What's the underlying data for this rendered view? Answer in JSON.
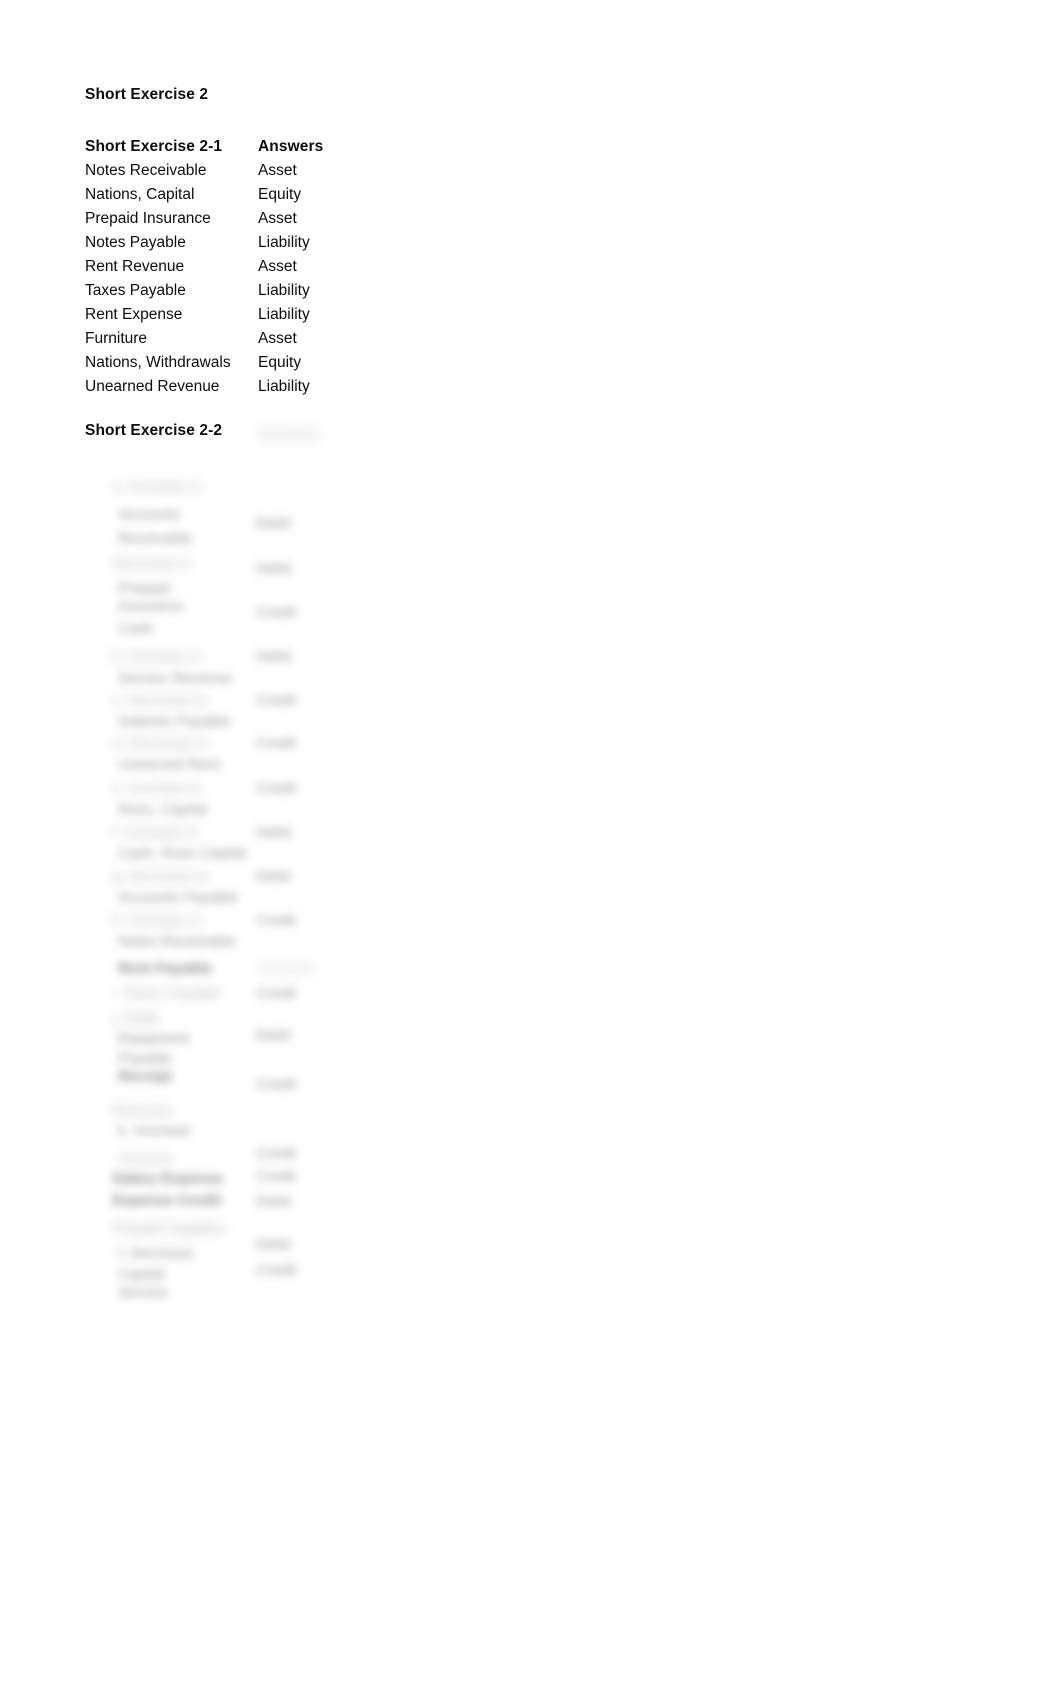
{
  "document": {
    "title": "Short Exercise 2",
    "background_color": "#ffffff",
    "text_color": "#0d0d0d"
  },
  "exercise_2_1": {
    "heading": "Short Exercise 2-1",
    "answers_header": "Answers",
    "rows": [
      {
        "account": "Notes Receivable",
        "answer": "Asset"
      },
      {
        "account": "Nations, Capital",
        "answer": "Equity"
      },
      {
        "account": "Prepaid Insurance",
        "answer": "Asset"
      },
      {
        "account": "Notes Payable",
        "answer": "Liability"
      },
      {
        "account": "Rent Revenue",
        "answer": "Asset"
      },
      {
        "account": "Taxes Payable",
        "answer": "Liability"
      },
      {
        "account": "Rent Expense",
        "answer": "Liability"
      },
      {
        "account": "Furniture",
        "answer": "Asset"
      },
      {
        "account": "Nations, Withdrawals",
        "answer": "Equity"
      },
      {
        "account": "Unearned Revenue",
        "answer": "Liability"
      }
    ]
  },
  "exercise_2_2": {
    "heading": "Short Exercise 2-2",
    "answers_header_obscured": "Answers",
    "content_state": "blurred",
    "obscured_rows": [
      {
        "left": "a. Increase in",
        "right": ""
      },
      {
        "left": "Accounts",
        "right": "Debit"
      },
      {
        "left": "Receivable",
        "right": ""
      },
      {
        "left": "Decrease in",
        "right": "Debit"
      },
      {
        "left": "Prepaid",
        "right": ""
      },
      {
        "left": "Insurance",
        "right": "Credit"
      },
      {
        "left": "Cash",
        "right": ""
      },
      {
        "left": "b. Increase in",
        "right": "Debit"
      },
      {
        "left": "Service Revenue",
        "right": ""
      },
      {
        "left": "c. Decrease in",
        "right": "Credit"
      },
      {
        "left": "Salaries Payable",
        "right": ""
      },
      {
        "left": "d. Decrease in",
        "right": "Credit"
      },
      {
        "left": "Unearned Rent",
        "right": ""
      },
      {
        "left": "e. Increase in",
        "right": "Credit"
      },
      {
        "left": "Ross, Capital",
        "right": ""
      },
      {
        "left": "f. Increase in",
        "right": "Debit"
      },
      {
        "left": "Cash, Ross Capital",
        "right": ""
      },
      {
        "left": "g. Decrease in",
        "right": "Debit"
      },
      {
        "left": "Accounts Payable",
        "right": ""
      },
      {
        "left": "h. Increase in",
        "right": "Credit"
      },
      {
        "left": "Notes Receivable",
        "right": ""
      },
      {
        "left": "Rent Payable",
        "right": "Answers"
      },
      {
        "left": "i. Taxes Payable",
        "right": "Credit"
      },
      {
        "left": "j. Debit",
        "right": ""
      },
      {
        "left": "Equipment",
        "right": "Debit"
      },
      {
        "left": "Payable",
        "right": ""
      },
      {
        "left": "Receipt",
        "right": "Credit"
      },
      {
        "left": "Revenue",
        "right": "Debit"
      },
      {
        "left": "k. Increase",
        "right": ""
      },
      {
        "left": "Account",
        "right": "Credit"
      },
      {
        "left": "Salary Expense",
        "right": "Credit"
      },
      {
        "left": "Expense Credit",
        "right": "Debit"
      },
      {
        "left": "Prepaid Supplies",
        "right": "Debit"
      },
      {
        "left": "l. Decrease",
        "right": ""
      },
      {
        "left": "Capital",
        "right": "Debit"
      },
      {
        "left": "Service",
        "right": "Credit"
      }
    ]
  }
}
